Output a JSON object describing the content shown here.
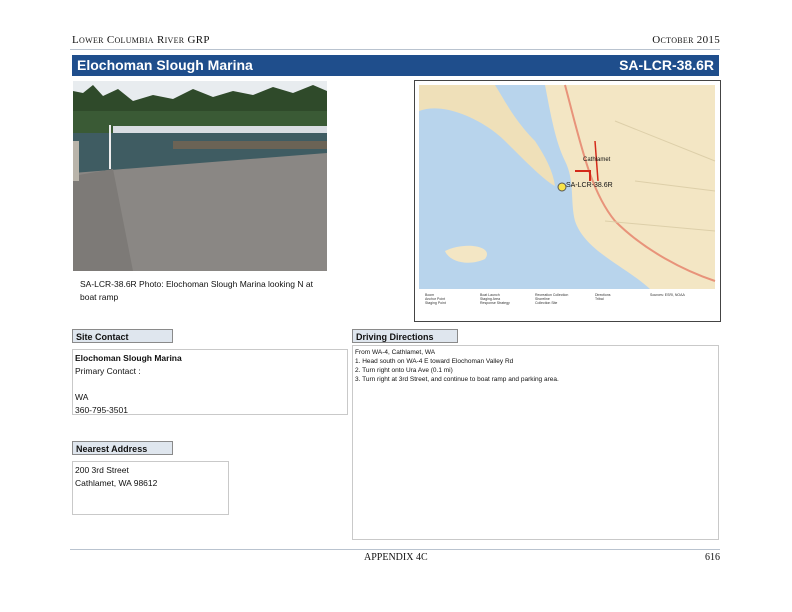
{
  "header": {
    "left": "Lower Columbia River GRP",
    "right": "October 2015"
  },
  "title": {
    "name": "Elochoman Slough Marina",
    "code": "SA-LCR-38.6R"
  },
  "photo_caption": "SA-LCR-38.6R Photo: Elochoman Slough Marina looking N at boat ramp",
  "map": {
    "site_label": "SA-LCR-38.6R",
    "town_label": "Cathlamet",
    "legend": {
      "col1": [
        "Boom",
        "Anchor Point",
        "Staging Point"
      ],
      "col2": [
        "Boat Launch",
        "Staging Area",
        "Response Strategy"
      ],
      "col3": [
        "Recreation Collection",
        "Shoreline",
        "Collection Site"
      ],
      "col4": [
        "Directions",
        "Tribal"
      ],
      "scale_note": "Sources: ESRI, NOAA"
    }
  },
  "site_contact": {
    "label": "Site Contact",
    "name": "Elochoman Slough Marina",
    "primary_contact": "Primary Contact :",
    "state": "WA",
    "phone": "360-795-3501"
  },
  "nearest_address": {
    "label": "Nearest Address",
    "line1": "200 3rd Street",
    "line2": "Cathlamet, WA  98612"
  },
  "driving_directions": {
    "label": "Driving Directions",
    "lines": [
      "From WA-4, Cathlamet, WA",
      "1. Head south on WA-4 E toward Elochoman Valley Rd",
      "2. Turn right onto Ura Ave (0.1 mi)",
      "3. Turn right at 3rd Street, and continue to boat ramp and parking area."
    ]
  },
  "footer": {
    "center": "APPENDIX 4C",
    "page": "616"
  },
  "colors": {
    "title_bar": "#1f4e8c",
    "water": "#b8d4ec",
    "land": "#f3e6c4"
  }
}
